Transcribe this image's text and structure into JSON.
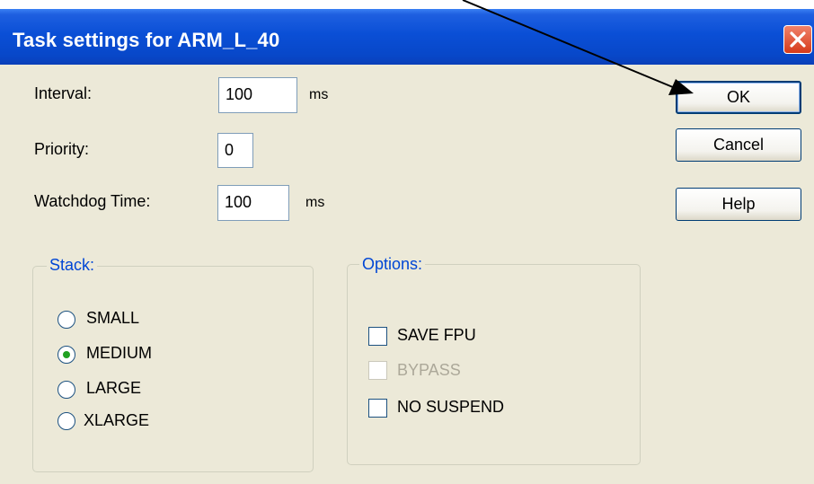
{
  "window": {
    "title": "Task settings for ARM_L_40"
  },
  "fields": {
    "interval": {
      "label": "Interval:",
      "value": "100",
      "unit": "ms"
    },
    "priority": {
      "label": "Priority:",
      "value": "0"
    },
    "watchdog": {
      "label": "Watchdog Time:",
      "value": "100",
      "unit": "ms"
    }
  },
  "buttons": {
    "ok": "OK",
    "cancel": "Cancel",
    "help": "Help"
  },
  "stack": {
    "title": "Stack:",
    "options": [
      "SMALL",
      "MEDIUM",
      "LARGE",
      "XLARGE"
    ],
    "selected": "MEDIUM"
  },
  "options": {
    "title": "Options:",
    "items": [
      {
        "label": "SAVE FPU",
        "checked": false,
        "enabled": true
      },
      {
        "label": "BYPASS",
        "checked": false,
        "enabled": false
      },
      {
        "label": "NO SUSPEND",
        "checked": false,
        "enabled": true
      }
    ]
  },
  "colors": {
    "title_bar": "#0a4fd6",
    "dialog_bg": "#ece9d8",
    "group_title": "#0046d5",
    "close_button": "#d63a1a"
  }
}
